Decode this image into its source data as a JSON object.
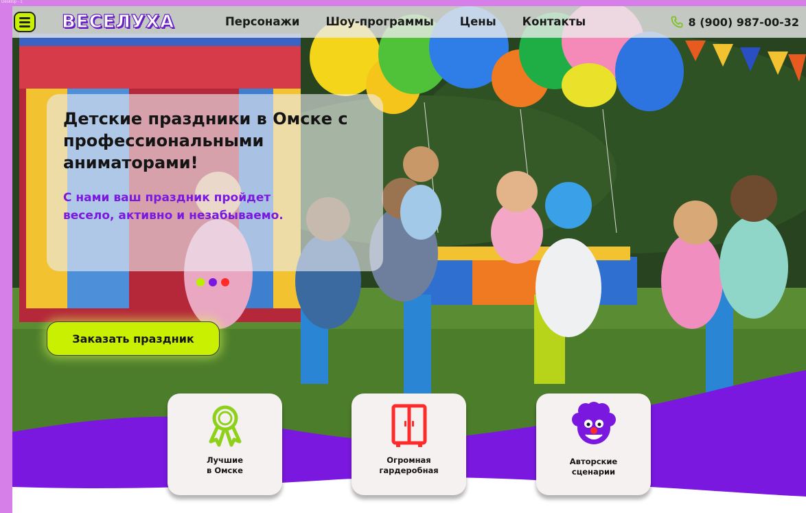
{
  "top_caption": "Desktop - 1",
  "header": {
    "logo_text": "ВЕСЕЛУХА",
    "nav": [
      "Персонажи",
      "Шоу-программы",
      "Цены",
      "Контакты"
    ],
    "phone": "8 (900) 987-00-32"
  },
  "hero": {
    "title": "Детские праздники в Омске с профессиональными аниматорами!",
    "subtitle": "С нами ваш праздник пройдет весело, активно и незабываемо.",
    "cta_label": "Заказать праздник",
    "slider_dot_colors": [
      "#b8f000",
      "#7a18e0",
      "#ff2a2a"
    ]
  },
  "features": [
    {
      "icon": "ribbon-award-icon",
      "label_line1": "Лучшие",
      "label_line2": "в Омске"
    },
    {
      "icon": "wardrobe-icon",
      "label_line1": "Огромная",
      "label_line2": "гардеробная"
    },
    {
      "icon": "clown-face-icon",
      "label_line1": "Авторские",
      "label_line2": "сценарии"
    }
  ],
  "colors": {
    "accent_lime": "#c8f000",
    "accent_purple": "#7a18e0",
    "page_frame": "#d77fe8"
  }
}
